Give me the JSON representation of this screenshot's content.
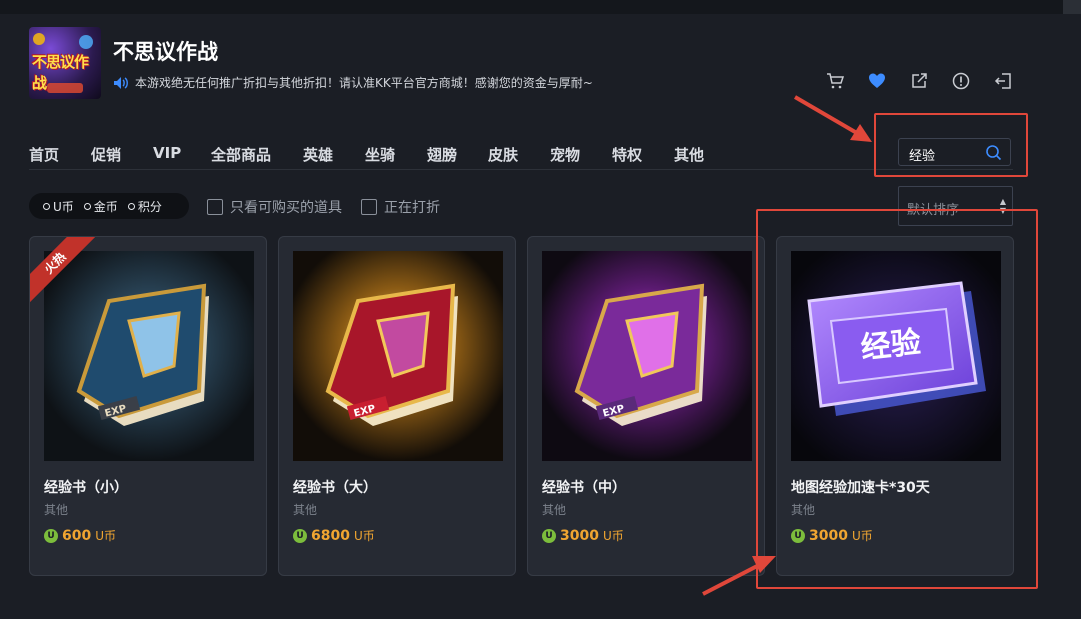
{
  "header": {
    "title": "不思议作战",
    "logo_text": "不思议作战",
    "notice": "本游戏绝无任何推广折扣与其他折扣！请认准KK平台官方商城！感谢您的资金与厚耐~"
  },
  "toolbar_icons": [
    "cart-icon",
    "heart-icon",
    "share-icon",
    "alert-icon",
    "exit-icon"
  ],
  "nav": {
    "items": [
      "首页",
      "促销",
      "VIP",
      "全部商品",
      "英雄",
      "坐骑",
      "翅膀",
      "皮肤",
      "宠物",
      "特权",
      "其他"
    ]
  },
  "search": {
    "value": "经验"
  },
  "filters": {
    "currency_options": [
      "U币",
      "金币",
      "积分"
    ],
    "only_buyable": "只看可购买的道具",
    "on_sale": "正在打折"
  },
  "sort": {
    "value": "默认排序"
  },
  "products": [
    {
      "name": "经验书（小）",
      "category": "其他",
      "price": "600",
      "unit": "U币",
      "badge": "火热",
      "art": "book-blue"
    },
    {
      "name": "经验书（大）",
      "category": "其他",
      "price": "6800",
      "unit": "U币",
      "badge": "",
      "art": "book-red"
    },
    {
      "name": "经验书（中）",
      "category": "其他",
      "price": "3000",
      "unit": "U币",
      "badge": "",
      "art": "book-purple"
    },
    {
      "name": "地图经验加速卡*30天",
      "category": "其他",
      "price": "3000",
      "unit": "U币",
      "badge": "",
      "art": "exp-card",
      "art_text": "经验"
    }
  ],
  "currency_icon_letter": "U",
  "colors": {
    "accent_price": "#f0a531",
    "highlight": "#e0473a",
    "heart": "#3d8cff"
  }
}
